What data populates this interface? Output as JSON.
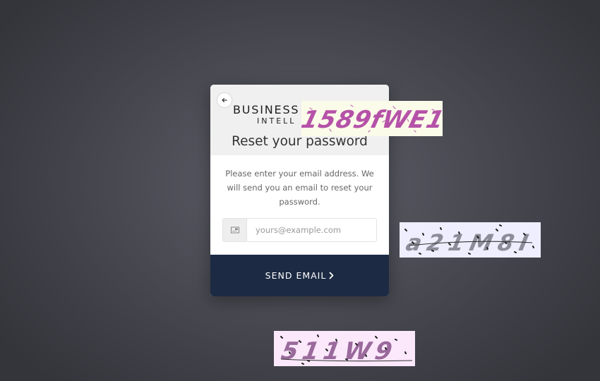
{
  "card": {
    "logo_line1": "BUSINESS",
    "logo_line2": "INTELL",
    "title": "Reset your password",
    "description": "Please enter your email address. We will send you an email to reset your password.",
    "email": {
      "value": "",
      "placeholder": "yours@example.com"
    },
    "submit_label": "SEND EMAIL"
  },
  "captchas": [
    {
      "text": "1589fWE1",
      "background": "#fbfbe9",
      "ink": "#b552a8"
    },
    {
      "text": "a21M8I",
      "background": "#eeeeff",
      "ink": "#8d8d99"
    },
    {
      "text": "511W9",
      "background": "#fbe8fb",
      "ink": "#9a6a9c"
    }
  ],
  "icons": {
    "back": "arrow-left-icon",
    "email": "envelope-icon",
    "submit": "chevron-right-icon"
  },
  "colors": {
    "button_bg": "#1c2a43",
    "header_bg": "#f0f0f0",
    "backdrop": "#4a4b53"
  }
}
